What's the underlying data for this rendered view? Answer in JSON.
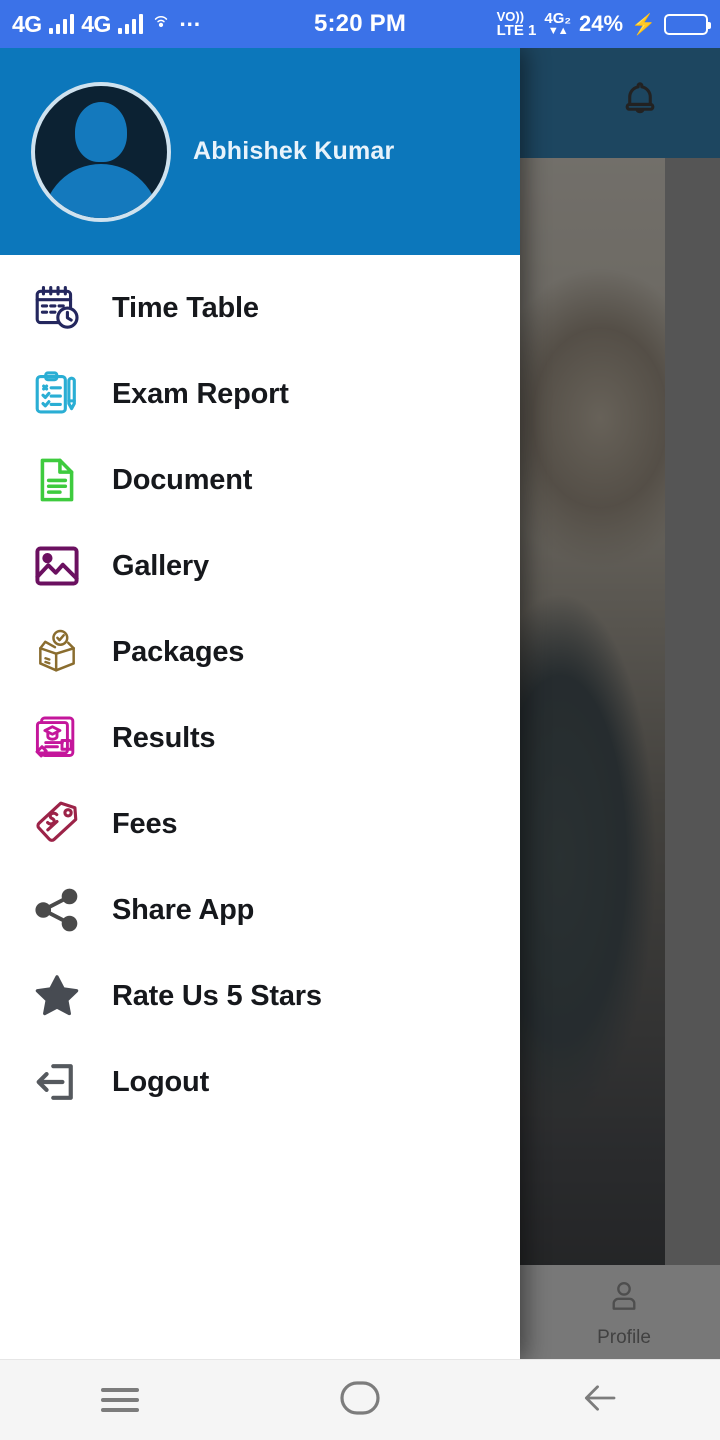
{
  "status_bar": {
    "network_1": "4G",
    "network_2": "4G",
    "dots": "···",
    "time": "5:20 PM",
    "volte_top": "VO))",
    "volte_bottom": "LTE 1",
    "data_top": "4G₂",
    "data_bottom": "▼▲",
    "battery_percent": "24%",
    "charging_glyph": "⚡",
    "battery_level": 24,
    "background_color": "#3b72e8",
    "battery_fill_color": "#f4a81d"
  },
  "drawer": {
    "header": {
      "profile_name": "Abhishek Kumar",
      "avatar_icon": "user-avatar-icon",
      "background_color": "#0c77bb"
    },
    "menu_items": [
      {
        "label": "Time Table",
        "icon": "calendar-clock-icon",
        "color": "#24275e"
      },
      {
        "label": "Exam Report",
        "icon": "clipboard-pen-icon",
        "color": "#2aaed4"
      },
      {
        "label": "Document",
        "icon": "document-lines-icon",
        "color": "#3ecb3e"
      },
      {
        "label": "Gallery",
        "icon": "image-photo-icon",
        "color": "#6b1060"
      },
      {
        "label": "Packages",
        "icon": "open-box-check-icon",
        "color": "#8a6d2f"
      },
      {
        "label": "Results",
        "icon": "graduation-certificate-icon",
        "color": "#c4169b"
      },
      {
        "label": "Fees",
        "icon": "price-tag-dollar-icon",
        "color": "#9c2348"
      },
      {
        "label": "Share App",
        "icon": "share-nodes-icon",
        "color": "#4a4a4a"
      },
      {
        "label": "Rate Us 5 Stars",
        "icon": "star-filled-icon",
        "color": "#474b52"
      },
      {
        "label": "Logout",
        "icon": "logout-arrow-icon",
        "color": "#55595e"
      }
    ]
  },
  "background_app": {
    "appbar": {
      "notification_icon": "bell-icon",
      "background_color": "#0c77bb"
    },
    "bottom_nav": [
      {
        "label": "Profile",
        "icon": "person-icon"
      }
    ]
  },
  "android_nav": {
    "recents_label": "recents",
    "home_label": "home",
    "back_label": "back",
    "recents_icon": "hamburger-menu-icon",
    "home_icon": "home-circle-icon",
    "back_icon": "back-arrow-icon"
  }
}
